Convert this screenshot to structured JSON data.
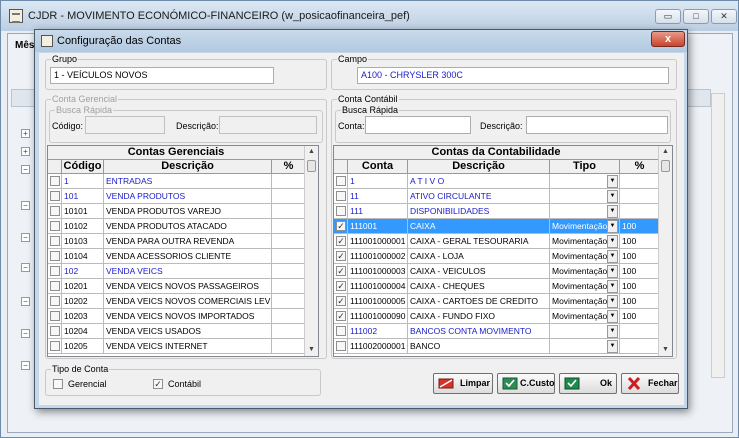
{
  "main_window": {
    "title": "CJDR - MOVIMENTO ECONÓMICO-FINANCEIRO (w_posicaofinanceira_pef)",
    "label_fragment": "Mês",
    "min_label": "▭",
    "max_label": "□",
    "close_label": "✕"
  },
  "dialog": {
    "title": "Configuração das Contas",
    "close_label": "x",
    "grupo": {
      "legend": "Grupo",
      "value": "1 - VEÍCULOS NOVOS"
    },
    "campo": {
      "legend": "Campo",
      "value": "A100 - CHRYSLER 300C"
    },
    "conta_gerencial": {
      "legend": "Conta Gerencial",
      "busca_legend": "Busca Rápida",
      "codigo_label": "Código:",
      "codigo_value": "",
      "descricao_label": "Descrição:",
      "descricao_value": ""
    },
    "conta_contabil": {
      "legend": "Conta Contábil",
      "busca_legend": "Busca Rápida",
      "conta_label": "Conta:",
      "conta_value": "",
      "descricao_label": "Descrição:",
      "descricao_value": ""
    },
    "grid_gerencial": {
      "title": "Contas Gerenciais",
      "columns": [
        "Código",
        "Descrição",
        "%"
      ],
      "rows": [
        {
          "checked": false,
          "codigo": "1",
          "descricao": "ENTRADAS",
          "pct": "",
          "header": true
        },
        {
          "checked": false,
          "codigo": "101",
          "descricao": "VENDA PRODUTOS",
          "pct": "",
          "header": true
        },
        {
          "checked": false,
          "codigo": "10101",
          "descricao": "VENDA PRODUTOS VAREJO",
          "pct": "",
          "header": false
        },
        {
          "checked": false,
          "codigo": "10102",
          "descricao": "VENDA PRODUTOS ATACADO",
          "pct": "",
          "header": false
        },
        {
          "checked": false,
          "codigo": "10103",
          "descricao": "VENDA PARA OUTRA REVENDA",
          "pct": "",
          "header": false
        },
        {
          "checked": false,
          "codigo": "10104",
          "descricao": "VENDA ACESSORIOS CLIENTE",
          "pct": "",
          "header": false
        },
        {
          "checked": false,
          "codigo": "102",
          "descricao": "VENDA VEICS",
          "pct": "",
          "header": true
        },
        {
          "checked": false,
          "codigo": "10201",
          "descricao": "VENDA VEICS NOVOS PASSAGEIROS",
          "pct": "",
          "header": false
        },
        {
          "checked": false,
          "codigo": "10202",
          "descricao": "VENDA VEICS NOVOS COMERCIAIS LEVES",
          "pct": "",
          "header": false
        },
        {
          "checked": false,
          "codigo": "10203",
          "descricao": "VENDA VEICS NOVOS IMPORTADOS",
          "pct": "",
          "header": false
        },
        {
          "checked": false,
          "codigo": "10204",
          "descricao": "VENDA VEICS USADOS",
          "pct": "",
          "header": false
        },
        {
          "checked": false,
          "codigo": "10205",
          "descricao": "VENDA VEICS INTERNET",
          "pct": "",
          "header": false
        }
      ]
    },
    "grid_contabil": {
      "title": "Contas da Contabilidade",
      "columns": [
        "Conta",
        "Descrição",
        "Tipo",
        "%"
      ],
      "rows": [
        {
          "checked": false,
          "conta": "1",
          "descricao": "A T I V O",
          "tipo": "",
          "pct": "",
          "header": true,
          "selected": false
        },
        {
          "checked": false,
          "conta": "11",
          "descricao": "ATIVO CIRCULANTE",
          "tipo": "",
          "pct": "",
          "header": true,
          "selected": false
        },
        {
          "checked": false,
          "conta": "111",
          "descricao": "DISPONIBILIDADES",
          "tipo": "",
          "pct": "",
          "header": true,
          "selected": false
        },
        {
          "checked": true,
          "conta": "111001",
          "descricao": "CAIXA",
          "tipo": "Movimentação",
          "pct": "100",
          "header": false,
          "selected": true
        },
        {
          "checked": true,
          "conta": "111001000001",
          "descricao": "CAIXA - GERAL TESOURARIA",
          "tipo": "Movimentação",
          "pct": "100",
          "header": false,
          "selected": false
        },
        {
          "checked": true,
          "conta": "111001000002",
          "descricao": "CAIXA - LOJA",
          "tipo": "Movimentação",
          "pct": "100",
          "header": false,
          "selected": false
        },
        {
          "checked": true,
          "conta": "111001000003",
          "descricao": "CAIXA - VEICULOS",
          "tipo": "Movimentação",
          "pct": "100",
          "header": false,
          "selected": false
        },
        {
          "checked": true,
          "conta": "111001000004",
          "descricao": "CAIXA - CHEQUES",
          "tipo": "Movimentação",
          "pct": "100",
          "header": false,
          "selected": false
        },
        {
          "checked": true,
          "conta": "111001000005",
          "descricao": "CAIXA - CARTOES DE CREDITO",
          "tipo": "Movimentação",
          "pct": "100",
          "header": false,
          "selected": false
        },
        {
          "checked": true,
          "conta": "111001000090",
          "descricao": "CAIXA - FUNDO FIXO",
          "tipo": "Movimentação",
          "pct": "100",
          "header": false,
          "selected": false
        },
        {
          "checked": false,
          "conta": "111002",
          "descricao": "BANCOS CONTA MOVIMENTO",
          "tipo": "",
          "pct": "",
          "header": true,
          "selected": false
        },
        {
          "checked": false,
          "conta": "111002000001",
          "descricao": "BANCO",
          "tipo": "",
          "pct": "",
          "header": false,
          "selected": false
        }
      ]
    },
    "tipo_conta": {
      "legend": "Tipo de Conta",
      "gerencial_label": "Gerencial",
      "gerencial_checked": false,
      "contabil_label": "Contábil",
      "contabil_checked": true
    },
    "buttons": {
      "limpar": "Limpar",
      "ccusto": "C.Custo",
      "ok": "Ok",
      "fechar": "Fechar"
    }
  }
}
